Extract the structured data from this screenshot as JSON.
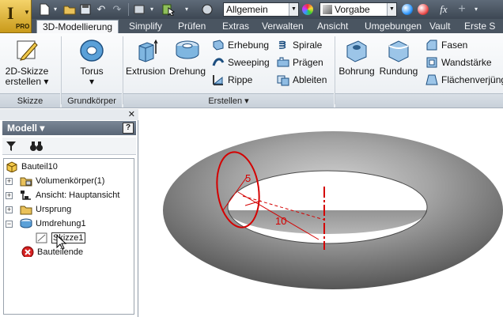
{
  "app": {
    "logo_glyph": "I",
    "edition": "PRO"
  },
  "quick_access": {
    "material_value": "Allgemein",
    "appearance_value": "Vorgabe",
    "fx_label": "fx"
  },
  "tabs": [
    {
      "label": "3D-Modellierung",
      "active": true
    },
    {
      "label": "Simplify"
    },
    {
      "label": "Prüfen"
    },
    {
      "label": "Extras"
    },
    {
      "label": "Verwalten"
    },
    {
      "label": "Ansicht"
    },
    {
      "label": "Umgebungen"
    },
    {
      "label": "Vault"
    },
    {
      "label": "Erste S"
    }
  ],
  "ribbon": {
    "panels": {
      "skizze": "Skizze",
      "grundkoerper": "Grundkörper",
      "erstellen": "Erstellen ▾"
    },
    "buttons": {
      "skizze2d_line1": "2D-Skizze",
      "skizze2d_line2": "erstellen ▾",
      "torus": "Torus",
      "torus_arrow": "▾",
      "extrusion": "Extrusion",
      "drehung": "Drehung",
      "erhebung": "Erhebung",
      "sweeping": "Sweeping",
      "rippe": "Rippe",
      "spirale": "Spirale",
      "praegen": "Prägen",
      "ableiten": "Ableiten",
      "bohrung": "Bohrung",
      "rundung": "Rundung",
      "fasen": "Fasen",
      "wandstaerke": "Wandstärke",
      "flaechenverjuengung": "Flächenverjüng"
    }
  },
  "browser": {
    "title": "Modell ▾",
    "help": "?",
    "tree": {
      "bauteil": "Bauteil10",
      "volumenkoerper": "Volumenkörper(1)",
      "ansicht": "Ansicht: Hauptansicht",
      "ursprung": "Ursprung",
      "umdrehung": "Umdrehung1",
      "skizze": "Skizze1",
      "bauteilende": "Bauteilende"
    }
  },
  "viewport": {
    "dim_radius": "5",
    "dim_distance": "10",
    "colors": {
      "sketch": "#d40000",
      "torus": "#8a8a8a"
    }
  }
}
